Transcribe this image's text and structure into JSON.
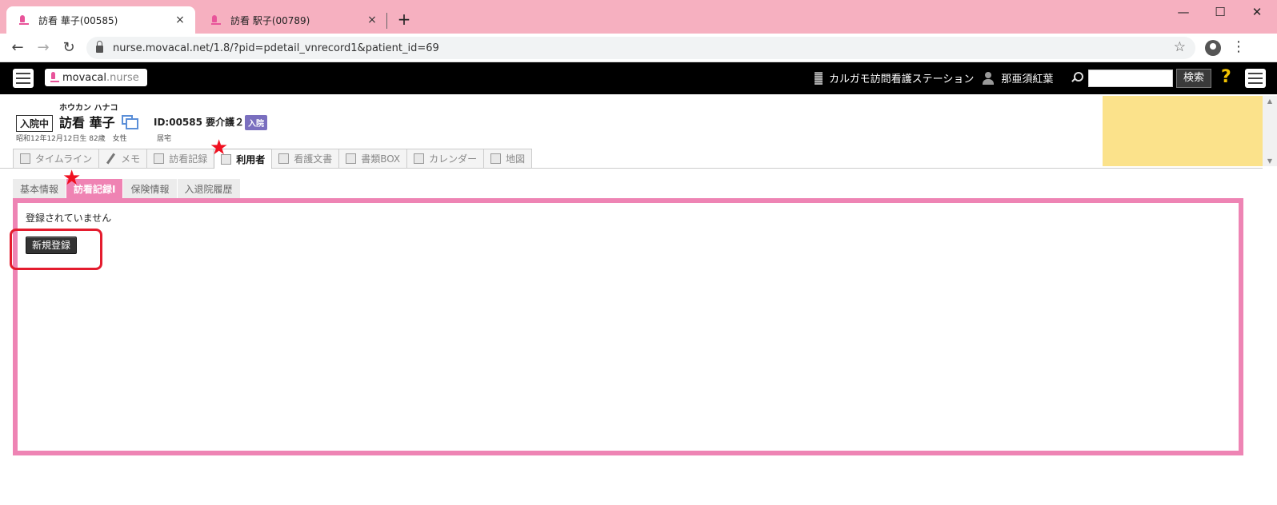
{
  "browser": {
    "tabs": [
      {
        "title": "訪看 華子(00585)",
        "active": true
      },
      {
        "title": "訪看 駅子(00789)",
        "active": false
      }
    ],
    "new_tab": "+",
    "close_glyph": "×",
    "window_controls": {
      "minimize": "—",
      "maximize": "☐",
      "close": "✕"
    },
    "url": "nurse.movacal.net/1.8/?pid=pdetail_vnrecord1&patient_id=69",
    "tab_strip_color": "#f6b0c0"
  },
  "app": {
    "logo_main": "movacal",
    "logo_sub": ".nurse",
    "station_name": "カルガモ訪問看護ステーション",
    "user_name": "那亜須紅葉",
    "search_placeholder": "",
    "search_button": "検索",
    "help": "?"
  },
  "patient": {
    "kana": "ホウカン ハナコ",
    "status": "入院中",
    "name": "訪看 華子",
    "id_care": "ID:00585 要介護２",
    "admit_badge": "入院",
    "birth": "昭和12年12月12日生 82歳　女性",
    "residence": "居宅"
  },
  "main_tabs": [
    {
      "label": "タイムライン",
      "icon": "timeline-icon",
      "active": false
    },
    {
      "label": "メモ",
      "icon": "pencil-icon",
      "active": false
    },
    {
      "label": "訪看記録",
      "icon": "record-icon",
      "active": false
    },
    {
      "label": "利用者",
      "icon": "user-card-icon",
      "active": true
    },
    {
      "label": "看護文書",
      "icon": "pdf-icon",
      "active": false
    },
    {
      "label": "書類BOX",
      "icon": "box-icon",
      "active": false
    },
    {
      "label": "カレンダー",
      "icon": "calendar-icon",
      "active": false
    },
    {
      "label": "地図",
      "icon": "map-icon",
      "active": false
    }
  ],
  "sub_tabs": [
    {
      "label": "基本情報",
      "active": false
    },
    {
      "label": "訪看記録I",
      "active": true
    },
    {
      "label": "保険情報",
      "active": false
    },
    {
      "label": "入退院履歴",
      "active": false
    }
  ],
  "content": {
    "empty_message": "登録されていません",
    "new_button": "新規登録"
  },
  "annotations": {
    "star": "★"
  },
  "colors": {
    "accent_pink": "#ee84b4",
    "admit_badge": "#7a6fbf",
    "annotation_red": "#e41c2e",
    "yellow_panel": "#fbe28b"
  }
}
